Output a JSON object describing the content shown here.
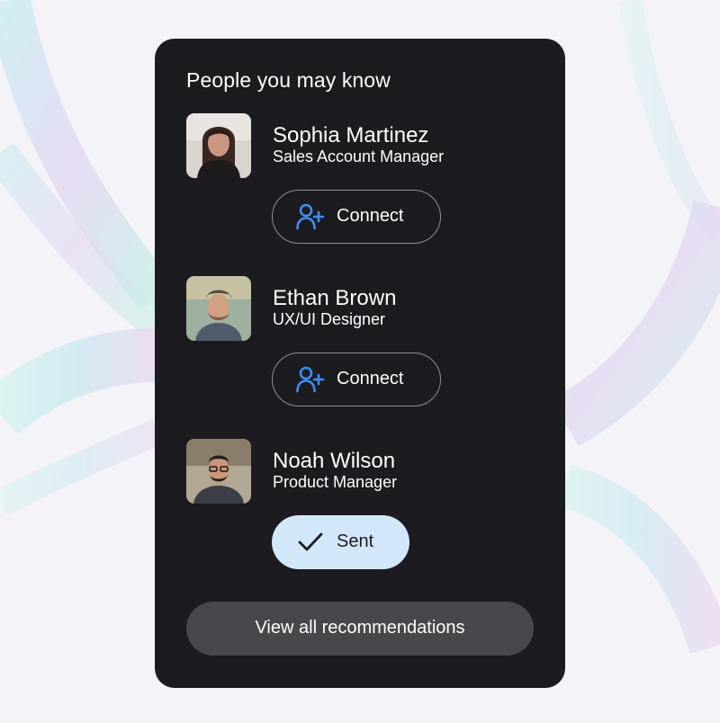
{
  "card": {
    "title": "People you may know"
  },
  "people": [
    {
      "name": "Sophia Martinez",
      "role": "Sales Account Manager",
      "action": {
        "label": "Connect",
        "icon": "add-person-icon",
        "state": "connect"
      }
    },
    {
      "name": "Ethan Brown",
      "role": "UX/UI Designer",
      "action": {
        "label": "Connect",
        "icon": "add-person-icon",
        "state": "connect"
      }
    },
    {
      "name": "Noah Wilson",
      "role": "Product Manager",
      "action": {
        "label": "Sent",
        "icon": "checkmark-icon",
        "state": "sent"
      }
    }
  ],
  "footer": {
    "view_all_label": "View all recommendations"
  },
  "colors": {
    "card_background": "#1c1b1f",
    "accent_icon": "#3e8ef7",
    "sent_background": "#d3e7fb",
    "footer_button": "#48474c",
    "page_background": "#f4f3f8"
  }
}
